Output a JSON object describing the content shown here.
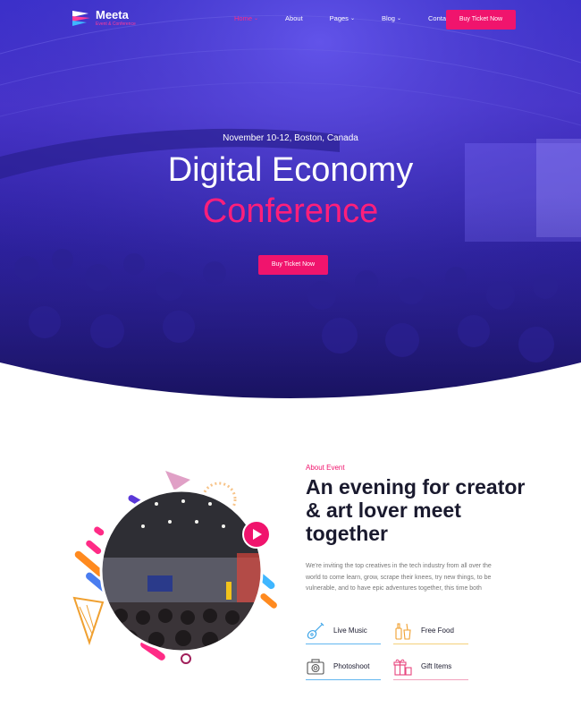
{
  "brand": {
    "name": "Meeta",
    "tagline": "Event & Conference",
    "colors": {
      "accent": "#f0146d",
      "hero": "#3a2fd0",
      "text": "#1a1a2e"
    }
  },
  "nav": {
    "items": [
      {
        "label": "Home",
        "has_dropdown": true,
        "active": true
      },
      {
        "label": "About",
        "has_dropdown": false
      },
      {
        "label": "Pages",
        "has_dropdown": true
      },
      {
        "label": "Blog",
        "has_dropdown": true
      },
      {
        "label": "Contact",
        "has_dropdown": false
      }
    ],
    "cta_label": "Buy Ticket Now"
  },
  "hero": {
    "date_location": "November 10-12, Boston, Canada",
    "title_line1": "Digital Economy",
    "title_line2": "Conference",
    "cta_label": "Buy Ticket Now"
  },
  "about": {
    "kicker": "About Event",
    "title": "An evening for creator & art lover meet together",
    "description": "We're inviting the top creatives in the tech industry from all over the world to come learn, grow, scrape their knees, try new things, to be vulnerable, and to have epic adventures together, this time both",
    "features": [
      {
        "label": "Live Music",
        "icon": "guitar-icon"
      },
      {
        "label": "Free Food",
        "icon": "drinks-icon"
      },
      {
        "label": "Photoshoot",
        "icon": "camera-icon"
      },
      {
        "label": "Gift Items",
        "icon": "gift-icon"
      }
    ]
  }
}
